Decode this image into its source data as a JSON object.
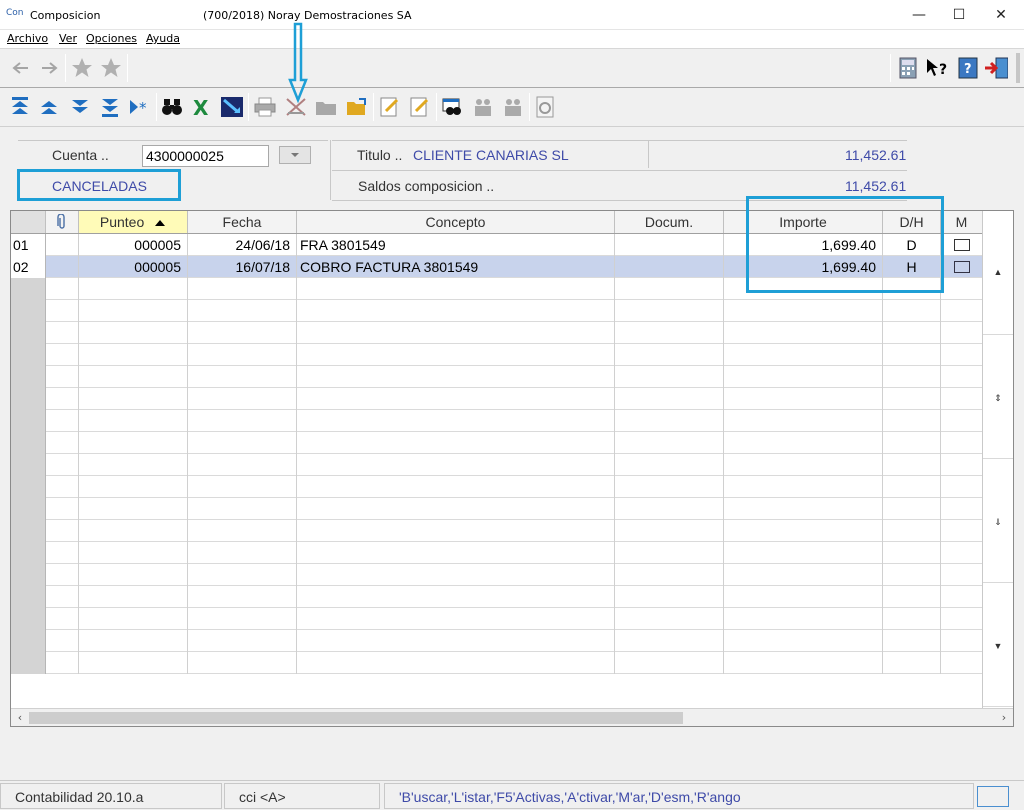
{
  "window": {
    "app_icon": "Con",
    "title": "Composicion",
    "company": "(700/2018) Noray Demostraciones SA",
    "controls": {
      "minimize": "—",
      "maximize": "☐",
      "close": "✕"
    }
  },
  "menu": [
    "Archivo",
    "Ver",
    "Opciones",
    "Ayuda"
  ],
  "toolbar1": {
    "left": [
      "back-arrow-icon",
      "forward-arrow-icon",
      "star-icon",
      "star-add-icon"
    ],
    "right": [
      "calculator-icon",
      "help-pointer-icon",
      "help-book-icon",
      "exit-door-icon"
    ]
  },
  "toolbar2": [
    "first-record-icon",
    "previous-record-icon",
    "next-record-icon",
    "last-record-icon",
    "new-record-icon",
    "binoculars-icon",
    "excel-icon",
    "chart-icon",
    "printer-icon",
    "delete-icon",
    "folder-icon",
    "open-folder-icon",
    "edit-note-icon",
    "edit-page-icon",
    "search-doc-icon",
    "users-icon",
    "users-gray-icon",
    "calculator-doc-icon"
  ],
  "form": {
    "cuenta_label": "Cuenta ..",
    "cuenta_value": "4300000025",
    "titulo_label": "Titulo ..",
    "titulo_value": "CLIENTE CANARIAS SL",
    "titulo_amount": "11,452.61",
    "canceladas": "CANCELADAS",
    "saldos_label": "Saldos composicion ..",
    "saldos_amount": "11,452.61"
  },
  "grid": {
    "columns": {
      "clip": "",
      "punteo": "Punteo",
      "fecha": "Fecha",
      "concepto": "Concepto",
      "docum": "Docum.",
      "importe": "Importe",
      "dh": "D/H",
      "m": "M"
    },
    "rows": [
      {
        "num": "01",
        "punteo": "000005",
        "fecha": "24/06/18",
        "concepto": "FRA 3801549",
        "docum": "",
        "importe": "1,699.40",
        "dh": "D"
      },
      {
        "num": "02",
        "punteo": "000005",
        "fecha": "16/07/18",
        "concepto": "COBRO FACTURA 3801549",
        "docum": "",
        "importe": "1,699.40",
        "dh": "H"
      }
    ]
  },
  "status": {
    "version": "Contabilidad 20.10.a",
    "user": "cci <A>",
    "hints": "'B'uscar,'L'istar,'F5'Activas,'A'ctivar,'M'ar,'D'esm,'R'ango"
  },
  "colors": {
    "highlight": "#1e9fd6",
    "blue_text": "#3e4aa8",
    "selected_row": "#c8d3ec"
  }
}
